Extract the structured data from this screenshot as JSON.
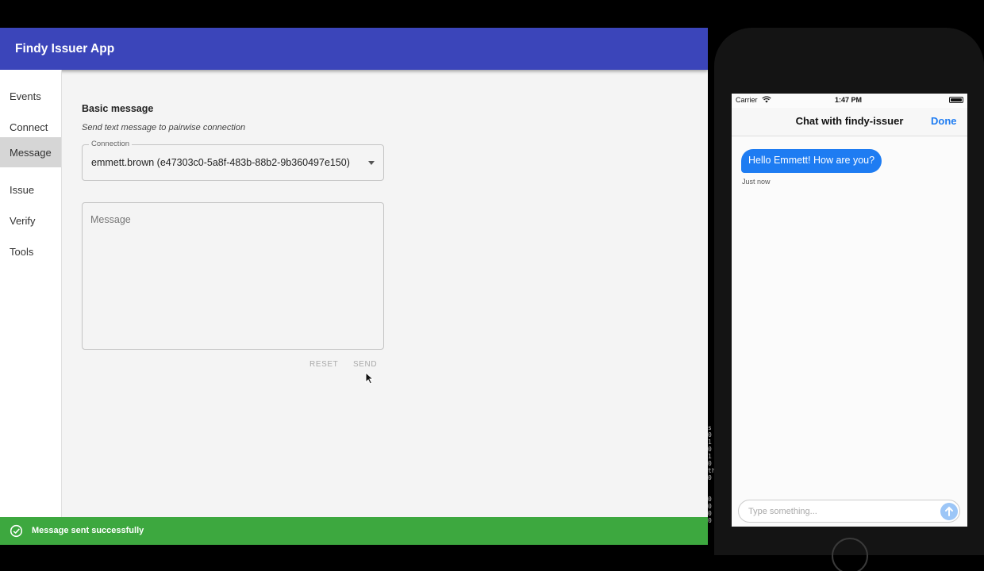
{
  "app": {
    "title": "Findy Issuer App",
    "accent_color": "#3b45ba"
  },
  "sidebar": {
    "items": [
      {
        "label": "Events",
        "active": false
      },
      {
        "label": "Connect",
        "active": false
      },
      {
        "label": "Message",
        "active": true
      },
      {
        "label": "Issue",
        "active": false
      },
      {
        "label": "Verify",
        "active": false
      },
      {
        "label": "Tools",
        "active": false
      }
    ]
  },
  "message_form": {
    "title": "Basic message",
    "subtitle": "Send text message to pairwise connection",
    "connection_label": "Connection",
    "connection_value": "emmett.brown (e47303c0-5a8f-483b-88b2-9b360497e150)",
    "message_placeholder": "Message",
    "reset_label": "RESET",
    "send_label": "SEND"
  },
  "snackbar": {
    "text": "Message sent successfully",
    "icon": "check-circle-icon",
    "color": "#3da83f"
  },
  "phone": {
    "status": {
      "carrier": "Carrier",
      "time": "1:47 PM"
    },
    "chat_title": "Chat with findy-issuer",
    "done_label": "Done",
    "messages": [
      {
        "text": "Hello Emmett! How are you?",
        "time": "Just now"
      }
    ],
    "input_placeholder": "Type something...",
    "bubble_color": "#1e7cf2"
  },
  "terminal_fragment": "s\n0\n1\n0\n1\n0\nth\n0\n\n\n0\n0\n0\n0"
}
